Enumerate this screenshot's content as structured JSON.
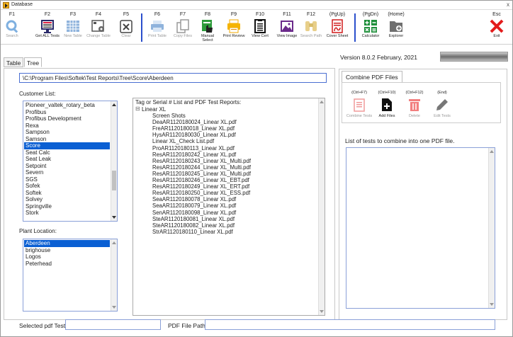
{
  "window": {
    "title": "Database",
    "close_label": "x"
  },
  "toolbar": {
    "buttons": [
      {
        "key": "F1",
        "label": "Search",
        "icon": "magnifier-icon"
      },
      {
        "key": "F2",
        "label": "Get ALL Tests",
        "icon": "monitor-list-icon"
      },
      {
        "key": "F3",
        "label": "New Table",
        "icon": "grid-icon"
      },
      {
        "key": "F4",
        "label": "Change Table",
        "icon": "table-gear-icon"
      },
      {
        "key": "F5",
        "label": "Clear",
        "icon": "clear-x-icon"
      },
      {
        "key": "F6",
        "label": "Print Table",
        "icon": "printer-icon"
      },
      {
        "key": "F7",
        "label": "Copy Files",
        "icon": "copy-icon"
      },
      {
        "key": "F8",
        "label": "Manual Select",
        "icon": "hand-select-icon"
      },
      {
        "key": "F9",
        "label": "Print Review",
        "icon": "print-review-icon"
      },
      {
        "key": "F10",
        "label": "View Cert",
        "icon": "certificate-icon"
      },
      {
        "key": "F11",
        "label": "View Image",
        "icon": "image-icon"
      },
      {
        "key": "F12",
        "label": "Search Path",
        "icon": "binoculars-icon"
      },
      {
        "key": "(PgUp)",
        "label": "Cover Sheet",
        "icon": "pdf-cover-icon"
      },
      {
        "key": "(PgDn)",
        "label": "Calculator",
        "icon": "calculator-icon"
      },
      {
        "key": "(Home)",
        "label": "Explorer",
        "icon": "folder-icon"
      },
      {
        "key": "Esc",
        "label": "Exit",
        "icon": "exit-x-icon"
      }
    ]
  },
  "tabs": [
    {
      "label": "Table"
    },
    {
      "label": "Tree"
    }
  ],
  "version": "Version 8.0.2 February, 2021",
  "path": "\\C:\\Program Files\\Softek\\Test Reports\\Tree\\Score\\Aberdeen",
  "customer": {
    "caption": "Customer List:",
    "items": [
      "Pioneer_valtek_rotary_beta",
      "Profibus",
      "Profibus Development",
      "Rexa",
      "Sampson",
      "Samson",
      "Score",
      "Seat Calc",
      "Seat Leak",
      "Setpoint",
      "Severn",
      "SGS",
      "Sofek",
      "Softek",
      "Solvey",
      "Springville",
      "Stork"
    ],
    "selected": "Score"
  },
  "plant": {
    "caption": "Plant Location:",
    "items": [
      "Aberdeen",
      "brighouse",
      "Logos",
      "Peterhead"
    ],
    "selected": "Aberdeen"
  },
  "tree": {
    "header": "Tag or Serial # List and PDF Test Reports:",
    "root": "Linear XL",
    "files": [
      "Screen Shots",
      "DeaAR1120180024_Linear XL.pdf",
      "FreAR1120180018_Linear XL.pdf",
      "HysAR1120180030_Linear XL.pdf",
      "Linear XL_Check List.pdf",
      "ProAR1120180113_Linear XL.pdf",
      "ResAR1120180242_Linear XL.pdf",
      "ResAR1120180243_Linear XL_Multi.pdf",
      "ResAR1120180244_Linear XL_Multi.pdf",
      "ResAR1120180245_Linear XL_Multi.pdf",
      "ResAR1120180246_Linear XL_EBT.pdf",
      "ResAR1120180249_Linear XL_ERT.pdf",
      "ResAR1120180250_Linear XL_ESS.pdf",
      "SeaAR1120180078_Linear XL.pdf",
      "SeaAR1120180079_Linear XL.pdf",
      "SenAR1120180098_Linear XL.pdf",
      "SteAR1120180081_Linear XL.pdf",
      "SteAR1120180082_Linear XL.pdf",
      "StrAR1120180110_Linear XL.pdf"
    ]
  },
  "combine": {
    "tab_label": "Combine PDF Files",
    "buttons": [
      {
        "key": "(Ctrl+F7)",
        "label": "Combine Tests"
      },
      {
        "key": "(Ctrl+F10)",
        "label": "Add Files"
      },
      {
        "key": "(Ctrl+F12)",
        "label": "Delete"
      },
      {
        "key": "(End)",
        "label": "Edit Tests"
      }
    ],
    "list_caption": "List of tests to combine into one PDF file."
  },
  "bottom": {
    "selected_label": "Selected pdf Test:",
    "path_label": "PDF File Path:",
    "selected_value": "",
    "path_value": ""
  },
  "colors": {
    "accent": "#2b4fcc",
    "selection": "#0a5fd3"
  }
}
